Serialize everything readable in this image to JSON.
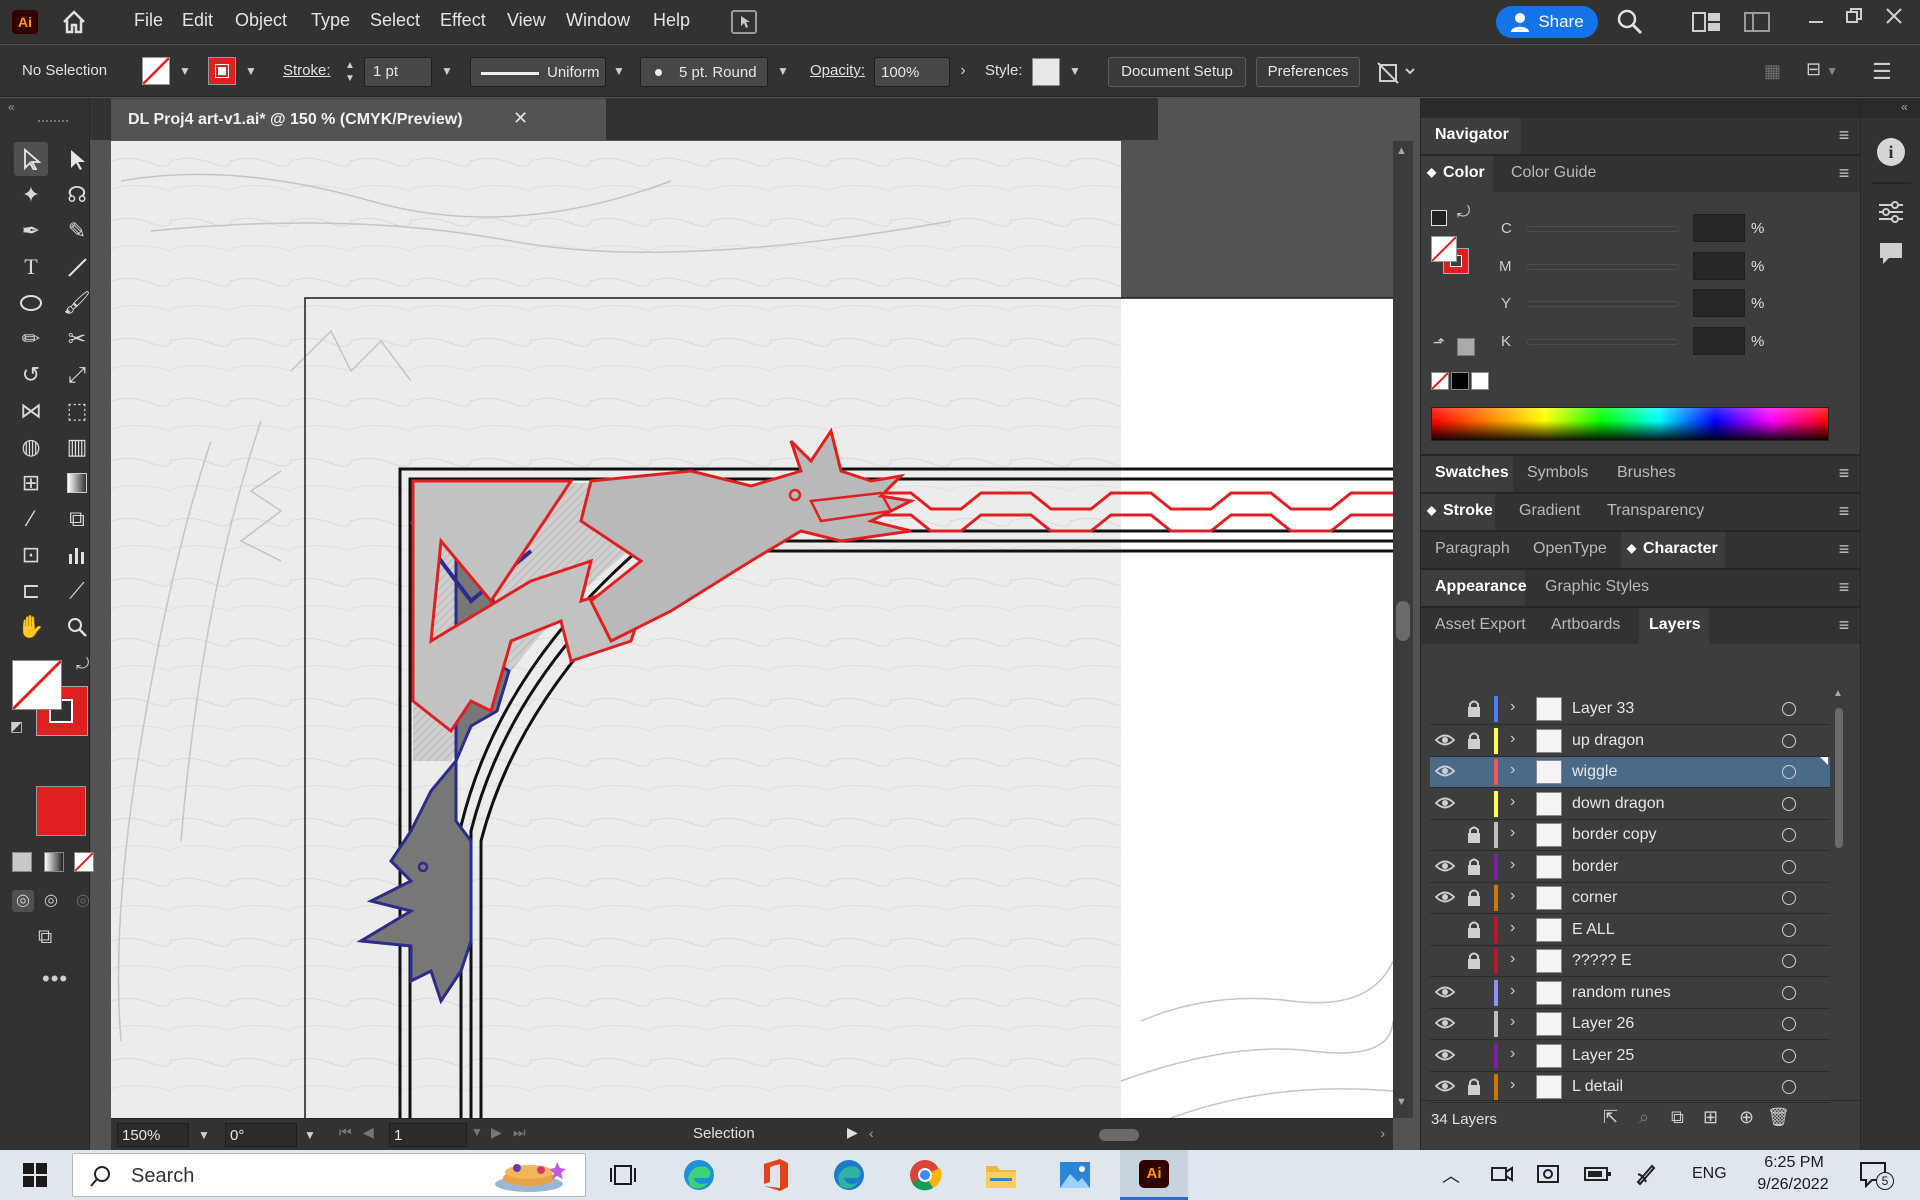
{
  "app": {
    "logo": "Ai",
    "brand_color": "#ff9a00",
    "logo_bg": "#330000"
  },
  "menubar": {
    "items": [
      "File",
      "Edit",
      "Object",
      "Type",
      "Select",
      "Effect",
      "View",
      "Window",
      "Help"
    ],
    "share_label": "Share",
    "share_color": "#1473e6"
  },
  "control_bar": {
    "selection_status": "No Selection",
    "stroke_label": "Stroke:",
    "stroke_weight": "1 pt",
    "profile_label": "Uniform",
    "brush_label": "5 pt. Round",
    "opacity_label": "Opacity:",
    "opacity_value": "100%",
    "style_label": "Style:",
    "document_setup": "Document Setup",
    "preferences": "Preferences"
  },
  "document": {
    "tab_title": "DL Proj4 art-v1.ai* @ 150 % (CMYK/Preview)"
  },
  "status_bar": {
    "zoom": "150%",
    "rotation": "0°",
    "artboard": "1",
    "tool_name": "Selection"
  },
  "panels": {
    "navigator": "Navigator",
    "color_tabs": [
      "Color",
      "Color Guide"
    ],
    "cmyk": [
      {
        "label": "C",
        "unit": "%"
      },
      {
        "label": "M",
        "unit": "%"
      },
      {
        "label": "Y",
        "unit": "%"
      },
      {
        "label": "K",
        "unit": "%"
      }
    ],
    "swatch_tabs": [
      "Swatches",
      "Symbols",
      "Brushes"
    ],
    "stroke_tabs": [
      "Stroke",
      "Gradient",
      "Transparency"
    ],
    "char_tabs": [
      "Paragraph",
      "OpenType",
      "Character"
    ],
    "appearance_tabs": [
      "Appearance",
      "Graphic Styles"
    ],
    "layers_tabs": [
      "Asset Export",
      "Artboards",
      "Layers"
    ],
    "layers_count": "34 Layers"
  },
  "layers": [
    {
      "name": "Layer 33",
      "color": "#4f7bff",
      "visible": false,
      "locked": true,
      "selected": false
    },
    {
      "name": "up dragon",
      "color": "#ffff4f",
      "visible": true,
      "locked": true,
      "selected": false
    },
    {
      "name": "wiggle",
      "color": "#ff4f4f",
      "visible": true,
      "locked": false,
      "selected": true
    },
    {
      "name": "down dragon",
      "color": "#ffff4f",
      "visible": true,
      "locked": false,
      "selected": false
    },
    {
      "name": "border copy",
      "color": "#bdbdbd",
      "visible": false,
      "locked": true,
      "selected": false
    },
    {
      "name": "border",
      "color": "#7a1fa0",
      "visible": true,
      "locked": true,
      "selected": false
    },
    {
      "name": "corner",
      "color": "#c87a00",
      "visible": true,
      "locked": true,
      "selected": false
    },
    {
      "name": "E ALL",
      "color": "#c0102c",
      "visible": false,
      "locked": true,
      "selected": false
    },
    {
      "name": "????? E",
      "color": "#c0102c",
      "visible": false,
      "locked": true,
      "selected": false
    },
    {
      "name": "random runes",
      "color": "#8f8fff",
      "visible": true,
      "locked": false,
      "selected": false
    },
    {
      "name": "Layer 26",
      "color": "#bdbdbd",
      "visible": true,
      "locked": false,
      "selected": false
    },
    {
      "name": "Layer 25",
      "color": "#7a1fa0",
      "visible": true,
      "locked": false,
      "selected": false
    },
    {
      "name": "L detail",
      "color": "#c87a00",
      "visible": true,
      "locked": true,
      "selected": false
    }
  ],
  "taskbar": {
    "search_placeholder": "Search",
    "time": "6:25 PM",
    "date": "9/26/2022",
    "language": "ENG",
    "notifications": "5"
  },
  "colors": {
    "accent_red": "#e02020",
    "accent_blue": "#2c2c8c",
    "selected_layer_bg": "#4a6a8a"
  }
}
